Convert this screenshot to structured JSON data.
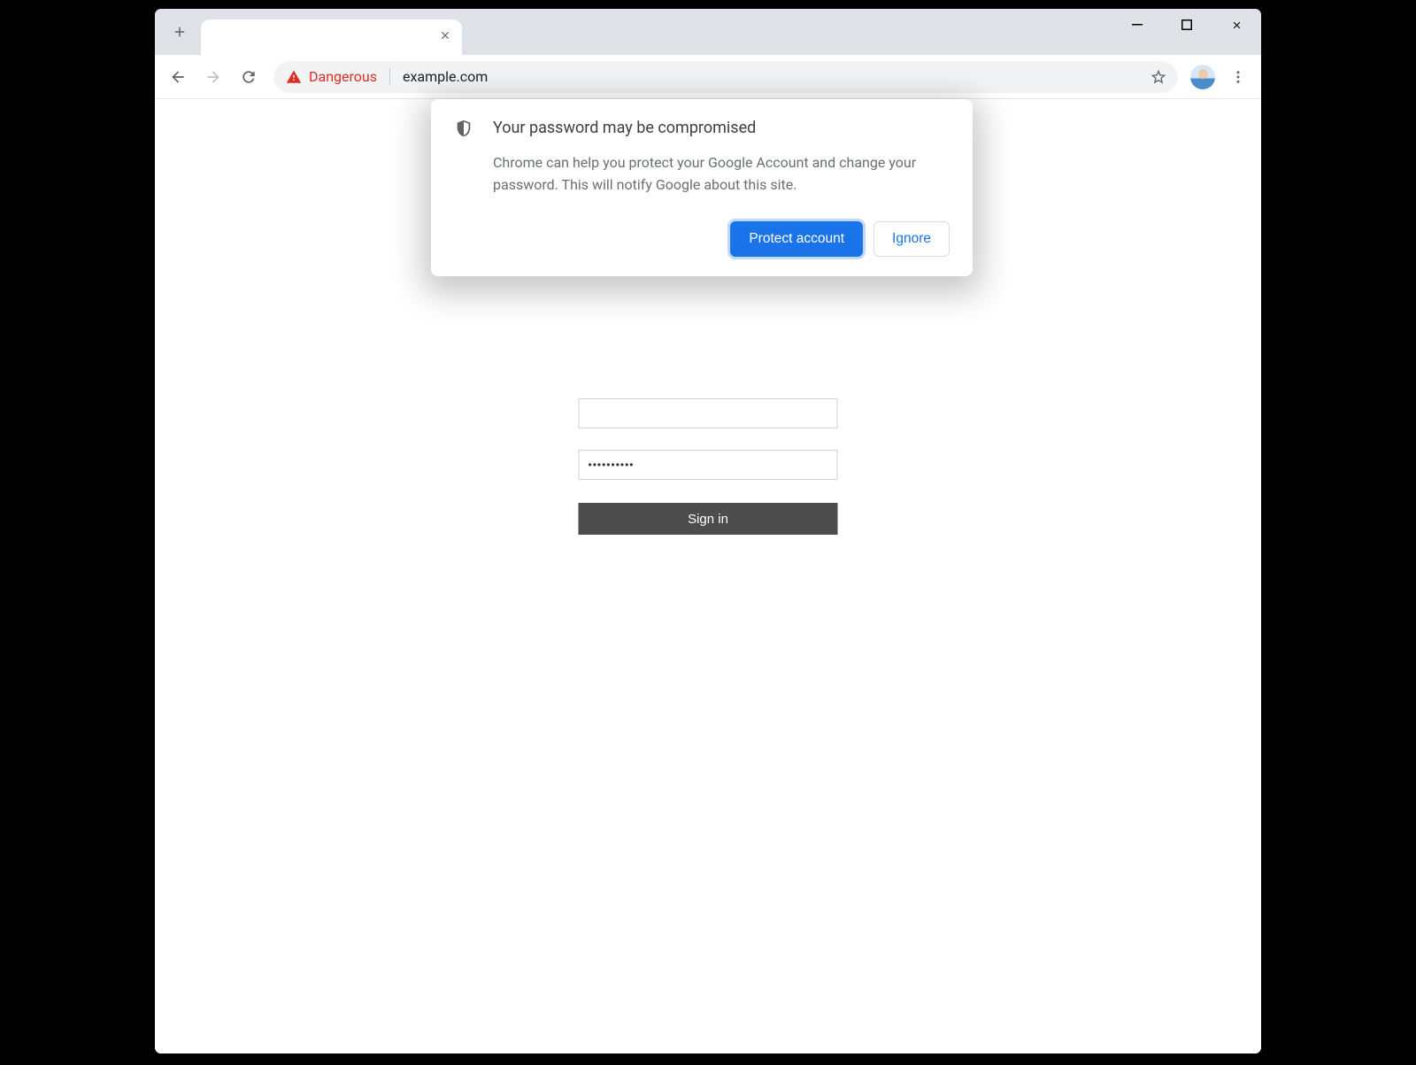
{
  "omnibox": {
    "security_label": "Dangerous",
    "url": "example.com"
  },
  "form": {
    "username_value": "",
    "password_value": "••••••••••",
    "signin_label": "Sign in"
  },
  "bubble": {
    "title": "Your password may be compromised",
    "body": "Chrome can help you protect your Google Account and change your password. This will notify Google about this site.",
    "primary_label": "Protect account",
    "secondary_label": "Ignore"
  }
}
